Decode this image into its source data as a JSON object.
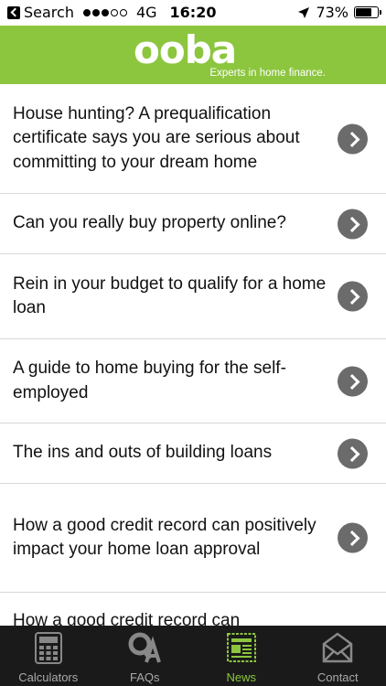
{
  "status_bar": {
    "back_label": "Search",
    "network": "4G",
    "time": "16:20",
    "battery": "73%",
    "battery_level": 0.73
  },
  "header": {
    "logo": "ooba",
    "tagline": "Experts in home finance.",
    "brand_color": "#8cc63e"
  },
  "articles": [
    {
      "title": "House hunting? A prequalification certificate says you are serious about committing to your dream home"
    },
    {
      "title": "Can you really buy property online?"
    },
    {
      "title": "Rein in your budget to qualify for a home loan"
    },
    {
      "title": "A guide to home buying for the self-employed"
    },
    {
      "title": "The ins and outs of building loans"
    },
    {
      "title": " How a good credit record can positively impact your home loan approval"
    },
    {
      "title": "How a good credit record can"
    }
  ],
  "tabs": [
    {
      "label": "Calculators",
      "icon": "calculator-icon"
    },
    {
      "label": "FAQs",
      "icon": "faq-icon"
    },
    {
      "label": "News",
      "icon": "newspaper-icon",
      "active": true
    },
    {
      "label": "Contact",
      "icon": "envelope-icon"
    }
  ]
}
